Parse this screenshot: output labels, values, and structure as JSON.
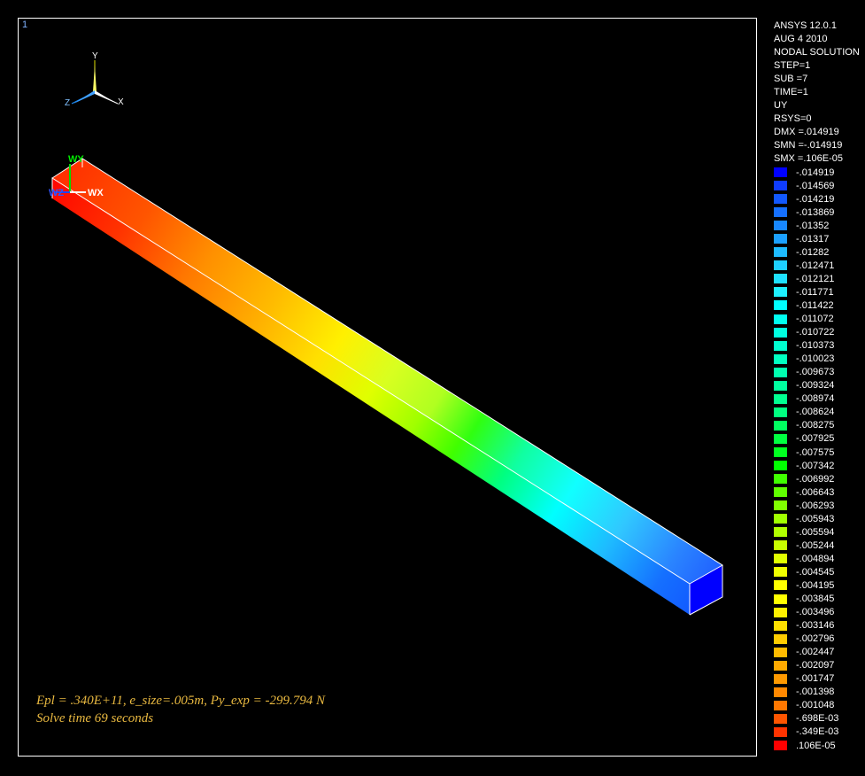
{
  "window": {
    "number": "1"
  },
  "info": {
    "lines": [
      "ANSYS 12.0.1",
      "AUG  4 2010",
      "NODAL SOLUTION",
      "STEP=1",
      "SUB =7",
      "TIME=1",
      "UY",
      "RSYS=0",
      "DMX =.014919",
      "SMN =-.014919",
      "SMX =.106E-05"
    ]
  },
  "triad": {
    "x": "X",
    "y": "Y",
    "z": "Z"
  },
  "workplane": {
    "wx": "WX",
    "wy": "WY",
    "wz": "WZ"
  },
  "annotations": {
    "line1": "Epl = .340E+11,  e_size=.005m, Py_exp = -299.794 N",
    "line2": "Solve time  69 seconds"
  },
  "contour": {
    "quantity": "UY",
    "min": -0.014919,
    "max": 1.06e-06
  },
  "legend": [
    {
      "label": "-.014919",
      "color": "#0000ff"
    },
    {
      "label": "-.014569",
      "color": "#0f3cff"
    },
    {
      "label": "-.014219",
      "color": "#1258ff"
    },
    {
      "label": "-.013869",
      "color": "#1570ff"
    },
    {
      "label": "-.01352",
      "color": "#1888ff"
    },
    {
      "label": "-.01317",
      "color": "#1ba0ff"
    },
    {
      "label": "-.01282",
      "color": "#1ebbff"
    },
    {
      "label": "-.012471",
      "color": "#1ed0ff"
    },
    {
      "label": "-.012121",
      "color": "#1ee0ff"
    },
    {
      "label": "-.011771",
      "color": "#1ef0ff"
    },
    {
      "label": "-.011422",
      "color": "#00ffff"
    },
    {
      "label": "-.011072",
      "color": "#00fff0"
    },
    {
      "label": "-.010722",
      "color": "#00ffe0"
    },
    {
      "label": "-.010373",
      "color": "#00ffd0"
    },
    {
      "label": "-.010023",
      "color": "#00ffc0"
    },
    {
      "label": "-.009673",
      "color": "#00ffb0"
    },
    {
      "label": "-.009324",
      "color": "#00ffa0"
    },
    {
      "label": "-.008974",
      "color": "#00ff90"
    },
    {
      "label": "-.008624",
      "color": "#00ff80"
    },
    {
      "label": "-.008275",
      "color": "#00ff60"
    },
    {
      "label": "-.007925",
      "color": "#00ff40"
    },
    {
      "label": "-.007575",
      "color": "#00ff20"
    },
    {
      "label": "-.007342",
      "color": "#00ff00"
    },
    {
      "label": "-.006992",
      "color": "#40ff00"
    },
    {
      "label": "-.006643",
      "color": "#60ff00"
    },
    {
      "label": "-.006293",
      "color": "#80ff00"
    },
    {
      "label": "-.005943",
      "color": "#a0ff00"
    },
    {
      "label": "-.005594",
      "color": "#b0ff00"
    },
    {
      "label": "-.005244",
      "color": "#c8ff00"
    },
    {
      "label": "-.004894",
      "color": "#e0ff00"
    },
    {
      "label": "-.004545",
      "color": "#f0ff00"
    },
    {
      "label": "-.004195",
      "color": "#ffff00"
    },
    {
      "label": "-.003845",
      "color": "#ffff00"
    },
    {
      "label": "-.003496",
      "color": "#fff000"
    },
    {
      "label": "-.003146",
      "color": "#ffe000"
    },
    {
      "label": "-.002796",
      "color": "#ffcc00"
    },
    {
      "label": "-.002447",
      "color": "#ffbb00"
    },
    {
      "label": "-.002097",
      "color": "#ffaa00"
    },
    {
      "label": "-.001747",
      "color": "#ff9900"
    },
    {
      "label": "-.001398",
      "color": "#ff8800"
    },
    {
      "label": "-.001048",
      "color": "#ff7700"
    },
    {
      "label": "-.698E-03",
      "color": "#ff5500"
    },
    {
      "label": "-.349E-03",
      "color": "#ff3300"
    },
    {
      "label": ".106E-05",
      "color": "#ff0000"
    }
  ]
}
